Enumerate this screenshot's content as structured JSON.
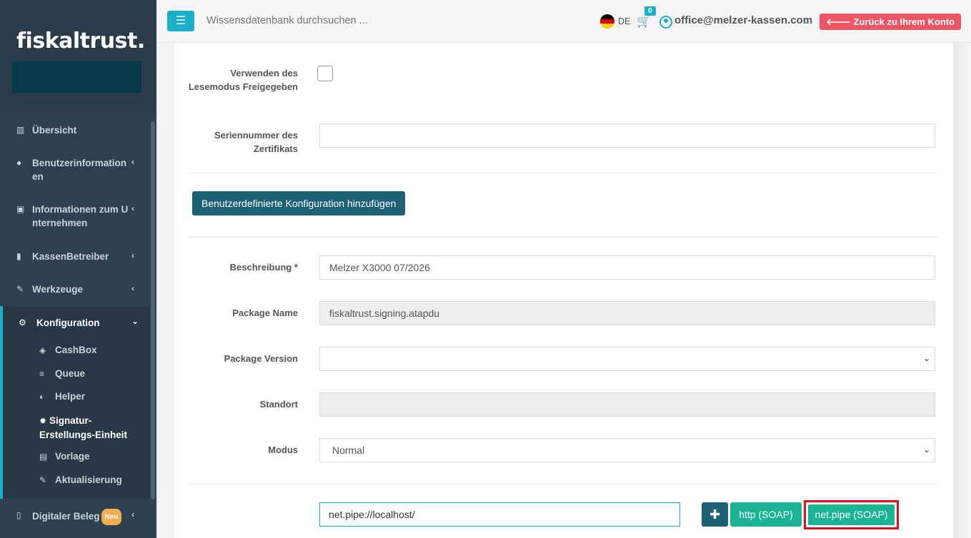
{
  "brand": {
    "logo_text": "fiskaltrust."
  },
  "topbar": {
    "search_placeholder": "Wissensdatenbank durchsuchen ...",
    "language": "DE",
    "cart_count": "0",
    "user_email": "office@melzer-kassen.com",
    "back_button": "Zurück zu Ihrem Konto"
  },
  "sidebar": {
    "items": [
      {
        "label": "Übersicht"
      },
      {
        "label": "Benutzerinformation en"
      },
      {
        "label": "Informationen zum U nternehmen"
      },
      {
        "label": "KassenBetreiber"
      },
      {
        "label": "Werkzeuge"
      },
      {
        "label": "Konfiguration"
      },
      {
        "label": "Digitaler Beleg",
        "badge": "Neu"
      }
    ],
    "sub_items": [
      {
        "label": "CashBox"
      },
      {
        "label": "Queue"
      },
      {
        "label": "Helper"
      },
      {
        "label": "Signatur-Erstellungs-Einheit"
      },
      {
        "label": "Vorlage"
      },
      {
        "label": "Aktualisierung"
      }
    ]
  },
  "form": {
    "readmode_label": "Verwenden des Lesemodus Freigegeben",
    "cert_serial_label": "Seriennummer des Zertifikats",
    "cert_serial_value": "",
    "add_config_button": "Benutzerdefinierte Konfiguration hinzufügen",
    "description_label": "Beschreibung *",
    "description_value": "Melzer X3000 07/2026",
    "package_name_label": "Package Name",
    "package_name_value": "fiskaltrust.signing.atapdu",
    "package_version_label": "Package Version",
    "package_version_value": "",
    "location_label": "Standort",
    "location_value": "",
    "mode_label": "Modus",
    "mode_value": "Normal",
    "url_value": "net.pipe://localhost/",
    "http_button": "http (SOAP)",
    "netpipe_button": "net.pipe (SOAP)"
  }
}
